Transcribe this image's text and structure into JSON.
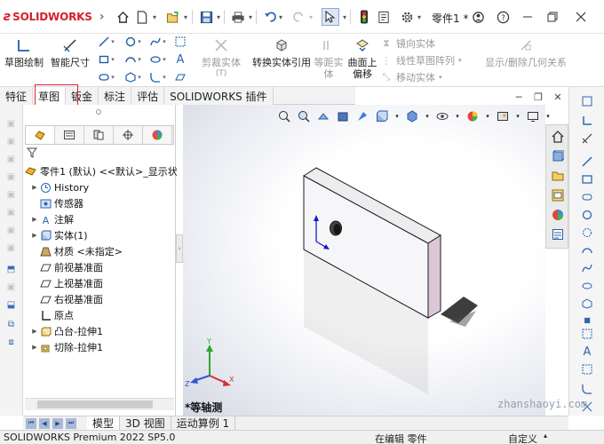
{
  "app": {
    "brand": "SOLIDWORKS",
    "document_title": "零件1 *"
  },
  "ribbon": {
    "sketch": "草图绘制",
    "smart_dimension": "智能尺寸",
    "trim_entities": "剪裁实体",
    "trim_entities_arrow": "(T)",
    "convert_entities": "转换实体引用",
    "offset_entities": [
      "等距实",
      "体"
    ],
    "offset_on_surface": [
      "曲面上",
      "偏移"
    ],
    "mirror_entities": "镜向实体",
    "linear_pattern": "线性草图阵列",
    "move_entities": "移动实体",
    "display_relations": "显示/删除几何关系"
  },
  "tabs": [
    "特征",
    "草图",
    "钣金",
    "标注",
    "评估",
    "SOLIDWORKS 插件"
  ],
  "active_tab": "草图",
  "tree": {
    "root": "零件1 (默认) <<默认>_显示状",
    "items": [
      {
        "label": "History",
        "icon": "history-icon",
        "expand": true
      },
      {
        "label": "传感器",
        "icon": "sensor-icon",
        "expand": false
      },
      {
        "label": "注解",
        "icon": "annotation-icon",
        "expand": true
      },
      {
        "label": "实体(1)",
        "icon": "solid-bodies-icon",
        "expand": true
      },
      {
        "label": "材质 <未指定>",
        "icon": "material-icon",
        "expand": false
      },
      {
        "label": "前视基准面",
        "icon": "plane-icon",
        "expand": false
      },
      {
        "label": "上视基准面",
        "icon": "plane-icon",
        "expand": false
      },
      {
        "label": "右视基准面",
        "icon": "plane-icon",
        "expand": false
      },
      {
        "label": "原点",
        "icon": "origin-icon",
        "expand": false
      },
      {
        "label": "凸台-拉伸1",
        "icon": "boss-extrude-icon",
        "expand": true
      },
      {
        "label": "切除-拉伸1",
        "icon": "cut-extrude-icon",
        "expand": true
      }
    ]
  },
  "view_label": "*等轴测",
  "triad": {
    "x": "X",
    "y": "Y",
    "z": "Z"
  },
  "bottom_tabs": [
    "模型",
    "3D 视图",
    "运动算例 1"
  ],
  "active_bottom_tab": "模型",
  "status": {
    "left": "SOLIDWORKS Premium 2022 SP5.0",
    "mode": "在编辑 零件",
    "custom": "自定义"
  },
  "watermark": "zhanshaoyi.com"
}
